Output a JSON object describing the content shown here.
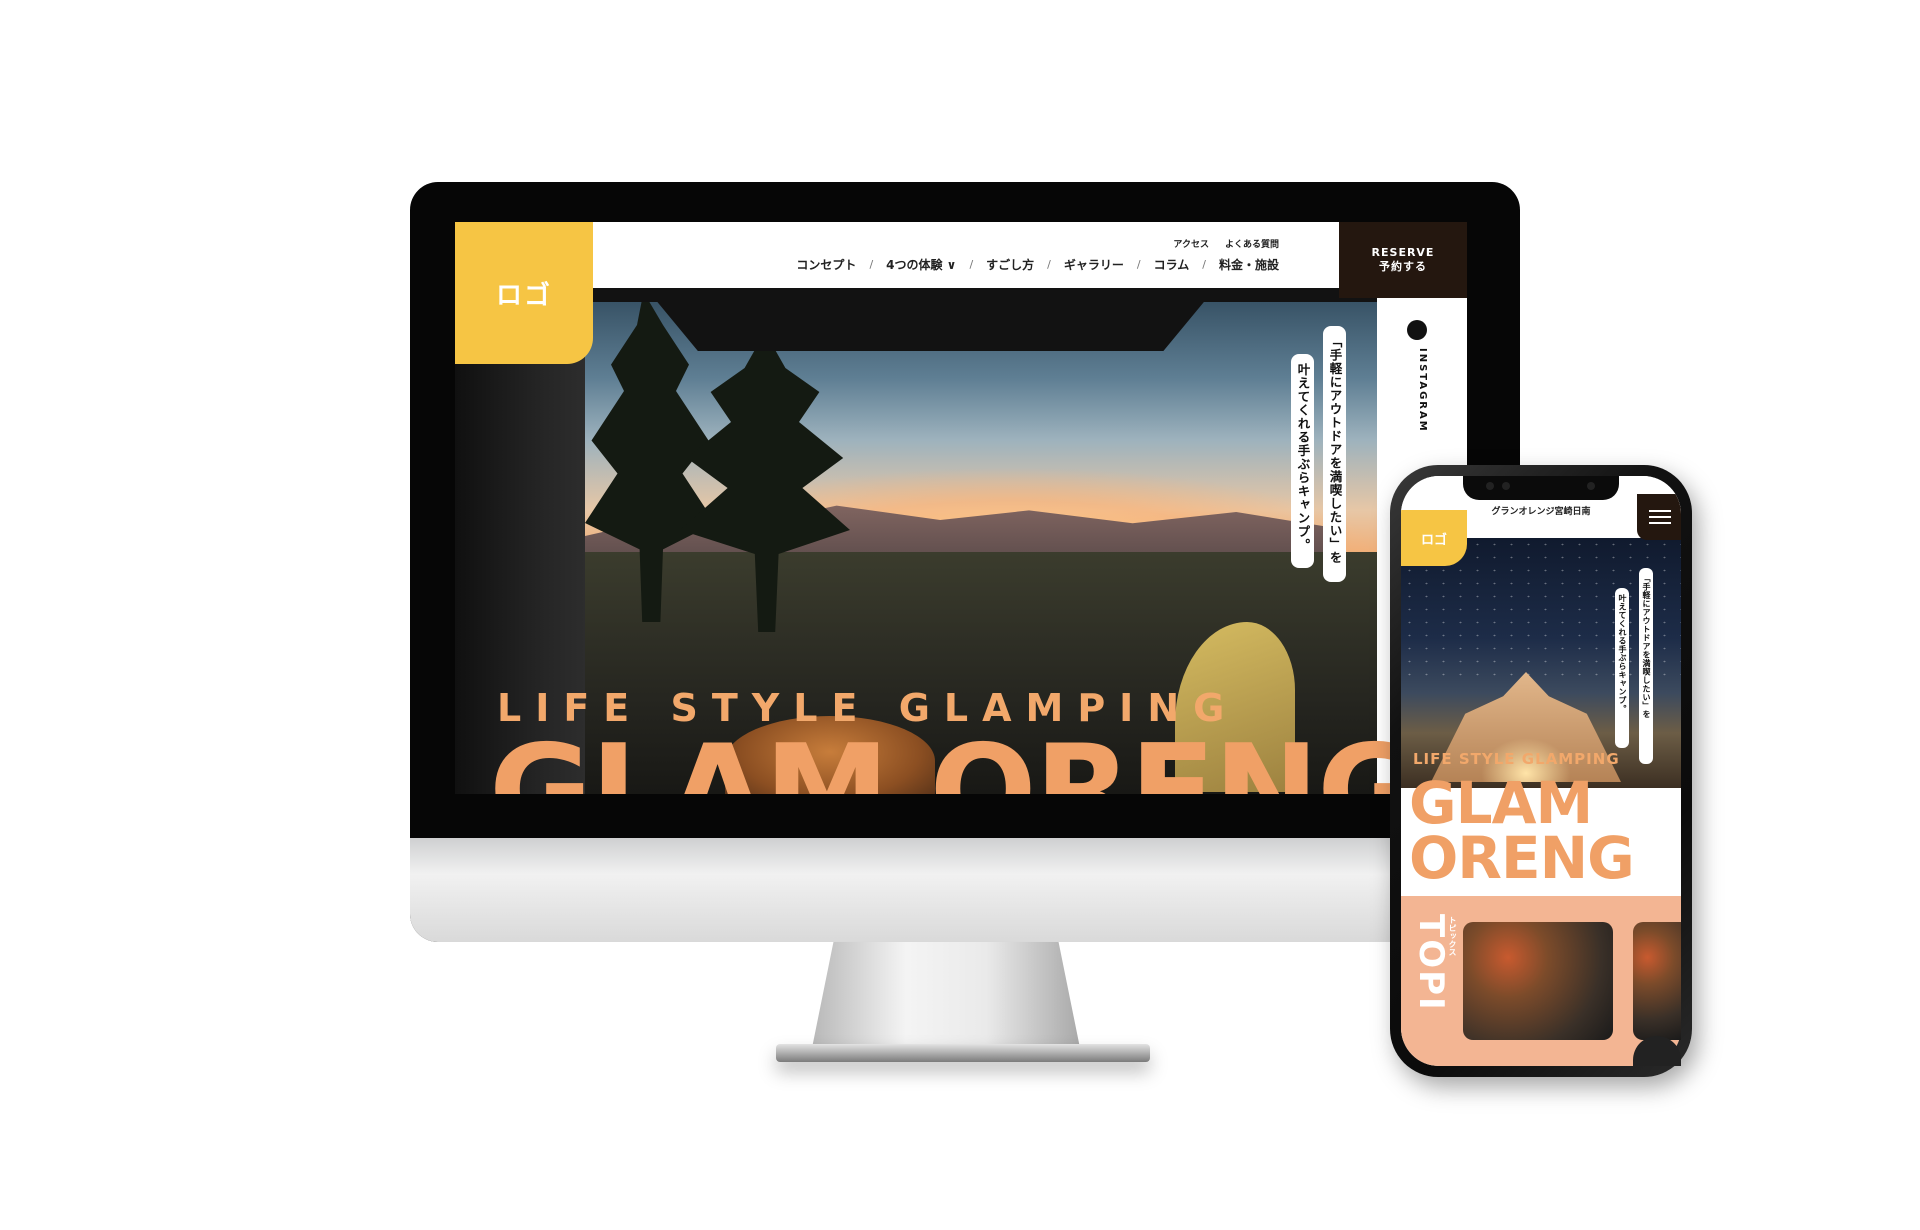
{
  "desktop": {
    "logo": "ロゴ",
    "nav_sub": [
      "アクセス",
      "よくある質問"
    ],
    "nav_main": [
      {
        "label": "コンセプト"
      },
      {
        "label": "4つの体験 ∨"
      },
      {
        "label": "すごし方"
      },
      {
        "label": "ギャラリー"
      },
      {
        "label": "コラム"
      },
      {
        "label": "料金・施設"
      }
    ],
    "nav_separator": "/",
    "reserve_en": "RESERVE",
    "reserve_ja": "予約する",
    "instagram": "INSTAGRAM",
    "copy_line1": "「手軽にアウトドアを満喫したい」を",
    "copy_line2": "叶えてくれる手ぶらキャンプ。",
    "tagline": "LIFE STYLE GLAMPING",
    "big_title": "GLAM ORENG"
  },
  "phone": {
    "site_name": "グランオレンジ宮崎日南",
    "logo": "ロゴ",
    "copy_line1": "「手軽にアウトドアを満喫したい」を",
    "copy_line2": "叶えてくれる手ぶらキャンプ。",
    "tagline": "LIFE STYLE GLAMPING",
    "big_title_line1": "GLAM",
    "big_title_line2": "ORENG",
    "topics_label": "TOPI",
    "topics_sub": "トピックス"
  },
  "colors": {
    "logo_yellow": "#f6c544",
    "title_orange": "#f0a066",
    "reserve_brown": "#24170f",
    "topics_peach": "#f3b593"
  }
}
